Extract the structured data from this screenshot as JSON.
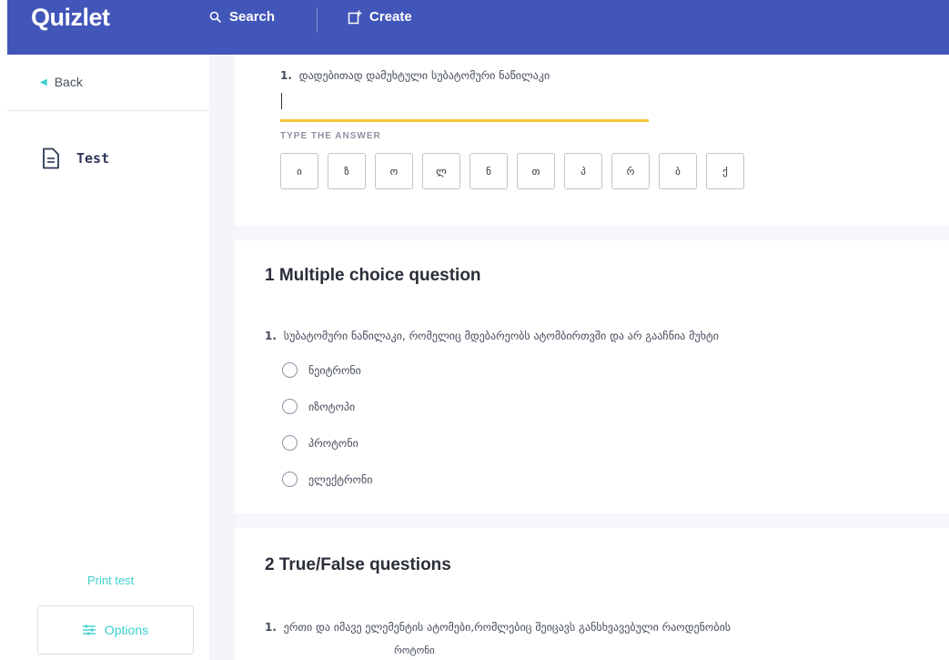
{
  "topbar": {
    "logo": "Quizlet",
    "search_label": "Search",
    "create_label": "Create"
  },
  "sidebar": {
    "back_label": "Back",
    "test_label": "Test",
    "print_label": "Print test",
    "options_label": "Options"
  },
  "written": {
    "question_number": "1.",
    "question_text": "დადებითად დამუხტული სუბატომური ნაწილაკი",
    "answer_value": "",
    "type_label": "TYPE THE ANSWER",
    "chars": [
      "ი",
      "ზ",
      "ო",
      "ლ",
      "ნ",
      "თ",
      "პ",
      "რ",
      "ბ",
      "ქ"
    ]
  },
  "multiple_choice": {
    "title": "1 Multiple choice question",
    "question_number": "1.",
    "question_text": "სუბატომური ნაწილაკი, რომელიც მდებარეობს ატომბირთვში და არ გააჩნია მუხტი",
    "options": [
      "ნეიტრონი",
      "იზოტოპი",
      "პროტონი",
      "ელექტრონი"
    ]
  },
  "true_false": {
    "title": "2 True/False questions",
    "question_number": "1.",
    "question_text": "ერთი და იმავე ელემენტის ატომები,რომლებიც შეიცავს განსხვავებული რაოდენობის",
    "answer_text": "როტონი"
  },
  "colors": {
    "topbar": "#4255b8",
    "accent": "#3ccfcf",
    "input_underline": "#f5c43a"
  }
}
